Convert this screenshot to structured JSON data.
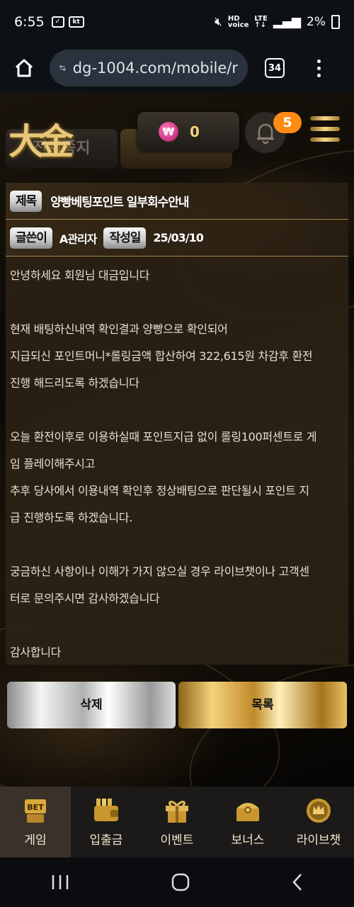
{
  "status_bar": {
    "time": "6:55",
    "carrier_badge": "kt",
    "battery": "2%"
  },
  "browser": {
    "url": "dg-1004.com/mobile/r",
    "tab_count": "34"
  },
  "header": {
    "logo_text": "大金",
    "tab_hidden_label": "전체쪽지",
    "wallet_value": "0",
    "wallet_icon": "₩",
    "notification_count": "5"
  },
  "article": {
    "title_label": "제목",
    "title": "양빵베팅포인트 일부회수안내",
    "author_label": "글쓴이",
    "author": "A관리자",
    "date_label": "작성일",
    "date": "25/03/10",
    "content": [
      "안녕하세요 회원님 대금입니다",
      "",
      "현재 배팅하신내역 확인결과 양빵으로 확인되어",
      "지급되신 포인트머니*롤링금액 합산하여 322,615원 차감후 환전",
      "진행 해드리도록 하겠습니다",
      "",
      "오늘 환전이후로 이용하실때 포인트지급 없이 롤링100퍼센트로 게",
      "임 플레이해주시고",
      "추후 당사에서 이용내역 확인후 정상배팅으로 판단될시 포인트 지",
      "급 진행하도록 하겠습니다.",
      "",
      "궁금하신 사항이나 이해가 가지 않으실 경우 라이브챗이나 고객센",
      "터로 문의주시면 감사하겠습니다",
      "",
      "감사합니다"
    ]
  },
  "buttons": {
    "delete": "삭제",
    "list": "목록"
  },
  "bottom_nav": [
    {
      "label": "게임",
      "icon": "bet-icon",
      "active": true
    },
    {
      "label": "입출금",
      "icon": "wallet-icon",
      "active": false
    },
    {
      "label": "이벤트",
      "icon": "gift-icon",
      "active": false
    },
    {
      "label": "보너스",
      "icon": "bonus-chest-icon",
      "active": false
    },
    {
      "label": "라이브챗",
      "icon": "crown-chat-icon",
      "active": false
    }
  ]
}
